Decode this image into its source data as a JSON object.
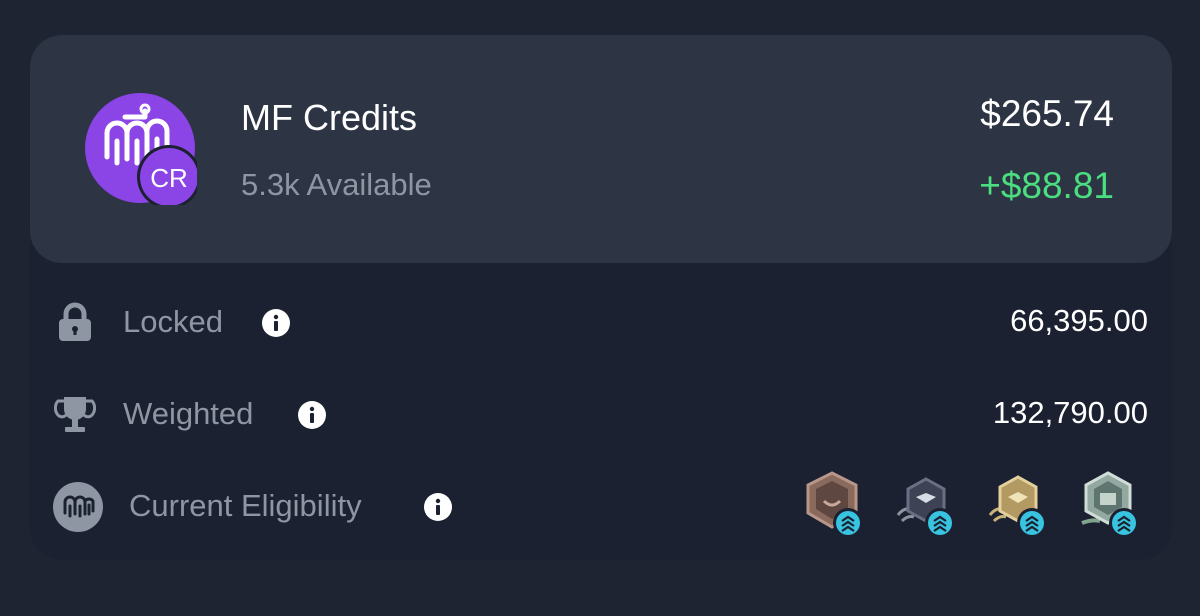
{
  "token": {
    "name": "MF Credits",
    "badge_text": "CR",
    "available": "5.3k Available",
    "value": "$265.74",
    "change": "+$88.81",
    "brand_color": "#8b44e6",
    "change_color": "#4ade80"
  },
  "rows": [
    {
      "label": "Locked",
      "icon": "lock-icon",
      "value": "66,395.00"
    },
    {
      "label": "Weighted",
      "icon": "trophy-icon",
      "value": "132,790.00"
    },
    {
      "label": "Current Eligibility",
      "icon": "mf-logo-icon"
    }
  ],
  "eligibility_badges": [
    {
      "name": "bronze-badge-icon",
      "color": "#9a7a6a"
    },
    {
      "name": "silver-badge-icon",
      "color": "#5a6175"
    },
    {
      "name": "gold-badge-icon",
      "color": "#c9b27a"
    },
    {
      "name": "platinum-badge-icon",
      "color": "#9cb0a5"
    }
  ]
}
